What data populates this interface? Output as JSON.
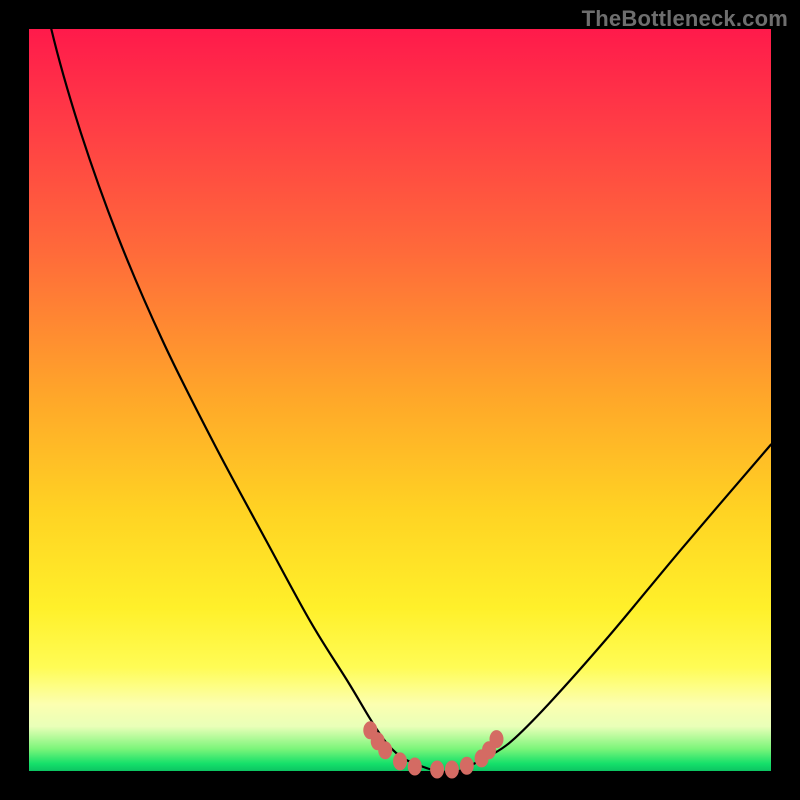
{
  "watermark": "TheBottleneck.com",
  "chart_data": {
    "type": "line",
    "title": "",
    "xlabel": "",
    "ylabel": "",
    "xlim": [
      0,
      100
    ],
    "ylim": [
      0,
      100
    ],
    "grid": false,
    "curve_desc": "V-shaped bottleneck curve reaching ~0 in the 50–60 range; left branch steeper than right",
    "x": [
      0,
      3,
      7,
      12,
      18,
      25,
      32,
      38,
      43,
      46,
      48,
      50,
      52,
      55,
      58,
      60,
      62,
      65,
      70,
      78,
      88,
      100
    ],
    "values": [
      115,
      100,
      86,
      72,
      58,
      44,
      31,
      20,
      12,
      7,
      4,
      2,
      1,
      0,
      0,
      1,
      2,
      4,
      9,
      18,
      30,
      44
    ],
    "markers": {
      "x": [
        46,
        47,
        48,
        50,
        52,
        55,
        57,
        59,
        61,
        62,
        63
      ],
      "y": [
        5.5,
        4.0,
        2.8,
        1.3,
        0.6,
        0.2,
        0.2,
        0.7,
        1.7,
        2.8,
        4.3
      ]
    }
  }
}
